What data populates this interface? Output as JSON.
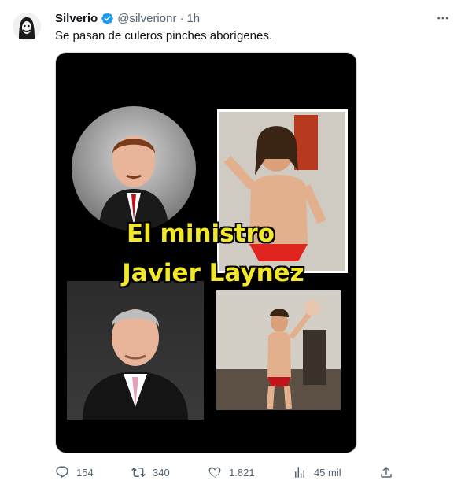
{
  "tweet": {
    "name": "Silverio",
    "handle": "@silverionr",
    "separator": "·",
    "time": "1h",
    "text": "Se pasan de culeros pinches aborígenes."
  },
  "media": {
    "overlay_line_1": "El ministro",
    "overlay_line_2": "Javier Laynez",
    "overlay_color": "#f2e72a"
  },
  "actions": {
    "replies": "154",
    "retweets": "340",
    "likes": "1.821",
    "views": "45 mil"
  },
  "icons": {
    "verified": "verified-badge-icon",
    "more": "more-options-icon",
    "reply": "reply-icon",
    "retweet": "retweet-icon",
    "like": "like-icon",
    "views": "views-icon",
    "share": "share-icon"
  },
  "colors": {
    "verified": "#1d9bf0",
    "secondary_text": "#536471"
  }
}
